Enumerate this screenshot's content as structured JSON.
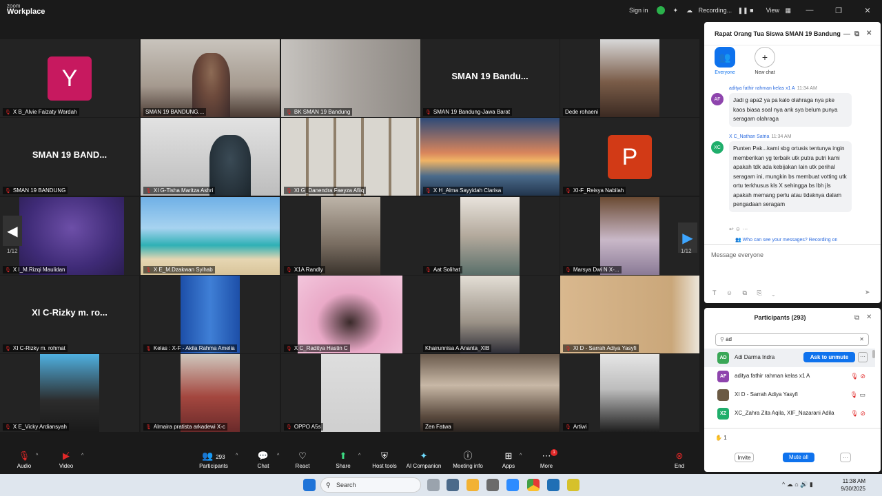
{
  "app": {
    "logo_line1": "zoom",
    "logo_line2": "Workplace"
  },
  "titlebar": {
    "sign_in": "Sign in",
    "recording": "Recording...",
    "view": "View"
  },
  "grid": {
    "page_left": "1/12",
    "page_right": "1/12",
    "tiles": [
      {
        "name": "X B_Alvie Faizaty Wardah",
        "avatar": "Y"
      },
      {
        "name": "SMAN 19 BANDUNG...."
      },
      {
        "name": "BK SMAN 19 Bandung"
      },
      {
        "name": "SMAN 19 Bandung-Jawa Barat",
        "big": "SMAN 19 Bandu..."
      },
      {
        "name": "Dede rohaeni"
      },
      {
        "name": "SMAN 19 BANDUNG",
        "big": "SMAN 19 BAND..."
      },
      {
        "name": "XI G-Tisha Maritza Ashri"
      },
      {
        "name": "XI G_Danendra Faeyza Afiiq"
      },
      {
        "name": "X H_Alma Sayyidah Clarisa"
      },
      {
        "name": "XI-F_Reisya Nabilah",
        "avatar": "P"
      },
      {
        "name": "X I_M.Rizqi Maulidan"
      },
      {
        "name": "X E_M.Dzakwan Syihab"
      },
      {
        "name": "X1A Randly"
      },
      {
        "name": "Aat Solihat"
      },
      {
        "name": "Marsya Dwi N X-..."
      },
      {
        "name": "XI C-Rizky m. rohmat",
        "big": "XI C-Rizky m. ro..."
      },
      {
        "name": "Kelas : X-F - Akila Rahma Amelia"
      },
      {
        "name": "X C_Raditya Hastin C"
      },
      {
        "name": "Khairunnisa A Ananta_XIB"
      },
      {
        "name": "XI D - Sarrah Adiya Yasyfi"
      },
      {
        "name": "X E_Vicky Ardiansyah"
      },
      {
        "name": "Almaira pratista arkadewi X-c"
      },
      {
        "name": "OPPO A5s"
      },
      {
        "name": "Zen Fatwa"
      },
      {
        "name": "Artiwi"
      }
    ]
  },
  "chat": {
    "title": "Rapat Orang Tua Siswa SMAN 19 Bandung",
    "tab_everyone": "Everyone",
    "tab_new_chat": "New chat",
    "messages": [
      {
        "initials": "AF",
        "sender": "aditya fathir rahman kelas x1 A",
        "time": "11:34 AM",
        "text": "Jadi g apa2 ya pa kalo olahraga nya pke kaos biasa soal nya ank sya belum punya seragam olahraga"
      },
      {
        "initials": "XC",
        "sender": "X C_Nathan Satria",
        "time": "11:34 AM",
        "text": "Punten Pak...kami sbg ortusis tentunya ingin memberikan yg terbaik utk putra putri kami apakah tdk ada kebijakan lain utk perihal seragam ini, mungkin bs membuat votting utk ortu terkhusus kls X sehingga bs lbh jls apakah memang perlu atau tidaknya dalam pengadaan seragam"
      }
    ],
    "who_can_see": "Who can see your messages? Recording on",
    "input_placeholder": "Message everyone"
  },
  "participants": {
    "title": "Participants (293)",
    "search_value": "ad",
    "rows": [
      {
        "initials": "AD",
        "name": "Adi Darma Indra",
        "color": "#3aa757"
      },
      {
        "initials": "AF",
        "name": "aditya fathir rahman kelas x1 A",
        "color": "#8e44ad"
      },
      {
        "initials": "",
        "name": "XI D - Sarrah Adiya Yasyfi",
        "color": "#6b5a44"
      },
      {
        "initials": "XZ",
        "name": "XC_Zahra Zita Aqila, XIF_Nazarani Adila",
        "color": "#1fae6b"
      }
    ],
    "ask_to_unmute": "Ask to unmute",
    "raised_count": "1",
    "invite": "Invite",
    "mute_all": "Mute all"
  },
  "toolbar": {
    "audio": "Audio",
    "video": "Video",
    "participants": "Participants",
    "participants_count": "293",
    "chat": "Chat",
    "react": "React",
    "share": "Share",
    "host_tools": "Host tools",
    "ai_companion": "AI Companion",
    "meeting_info": "Meeting info",
    "apps": "Apps",
    "more": "More",
    "more_badge": "1",
    "end": "End"
  },
  "taskbar": {
    "search": "Search",
    "time": "11:38 AM",
    "date": "9/30/2025"
  }
}
